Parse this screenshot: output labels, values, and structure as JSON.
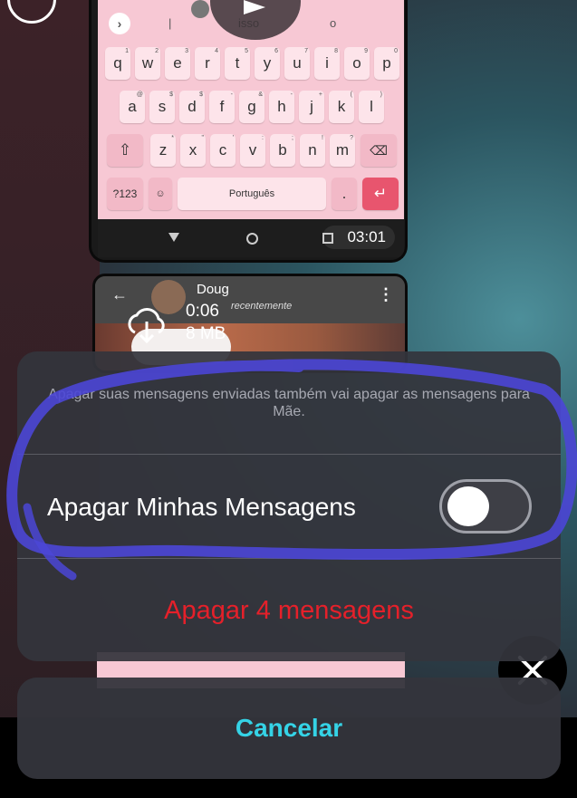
{
  "keyboard": {
    "suggestions": [
      "|",
      "isso",
      "o"
    ],
    "row1": [
      {
        "k": "q",
        "s": "1"
      },
      {
        "k": "w",
        "s": "2"
      },
      {
        "k": "e",
        "s": "3"
      },
      {
        "k": "r",
        "s": "4"
      },
      {
        "k": "t",
        "s": "5"
      },
      {
        "k": "y",
        "s": "6"
      },
      {
        "k": "u",
        "s": "7"
      },
      {
        "k": "i",
        "s": "8"
      },
      {
        "k": "o",
        "s": "9"
      },
      {
        "k": "p",
        "s": "0"
      }
    ],
    "row2": [
      {
        "k": "a",
        "s": "@"
      },
      {
        "k": "s",
        "s": "$"
      },
      {
        "k": "d",
        "s": "$"
      },
      {
        "k": "f",
        "s": "-"
      },
      {
        "k": "g",
        "s": "&"
      },
      {
        "k": "h",
        "s": "-"
      },
      {
        "k": "j",
        "s": "+"
      },
      {
        "k": "k",
        "s": "("
      },
      {
        "k": "l",
        "s": ")"
      }
    ],
    "row3": [
      {
        "k": "z",
        "s": "*"
      },
      {
        "k": "x",
        "s": "\""
      },
      {
        "k": "c",
        "s": "'"
      },
      {
        "k": "v",
        "s": ":"
      },
      {
        "k": "b",
        "s": ";"
      },
      {
        "k": "n",
        "s": "!"
      },
      {
        "k": "m",
        "s": "?"
      }
    ],
    "symbols_key": "?123",
    "space_label": "Português",
    "period_key": "."
  },
  "nav": {
    "timer": "03:01"
  },
  "chat": {
    "contact_name": "Doug",
    "status": "recentemente",
    "download_duration": "0:06",
    "download_size": "8 MB"
  },
  "dialog": {
    "message": "Apagar suas mensagens enviadas também vai apagar as mensagens para Mãe.",
    "toggle_label": "Apagar Minhas Mensagens",
    "toggle_on": false,
    "delete_label": "Apagar 4 mensagens",
    "cancel_label": "Cancelar"
  },
  "colors": {
    "delete": "#e5202a",
    "cancel": "#35d3e6",
    "annotation": "#4b46d6"
  }
}
